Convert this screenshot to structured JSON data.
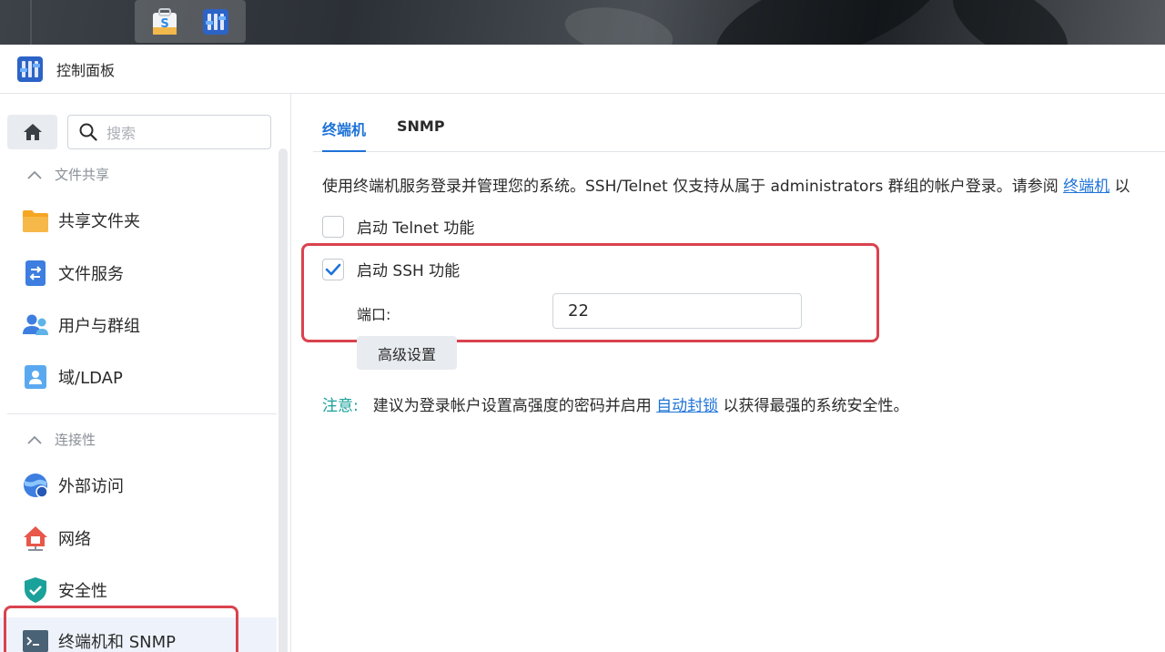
{
  "window": {
    "title": "控制面板"
  },
  "sidebar": {
    "search_placeholder": "搜索",
    "sections": [
      {
        "label": "文件共享",
        "items": [
          {
            "label": "共享文件夹",
            "icon": "folder-icon"
          },
          {
            "label": "文件服务",
            "icon": "file-services-icon"
          },
          {
            "label": "用户与群组",
            "icon": "users-icon"
          },
          {
            "label": "域/LDAP",
            "icon": "domain-icon"
          }
        ]
      },
      {
        "label": "连接性",
        "items": [
          {
            "label": "外部访问",
            "icon": "external-access-icon"
          },
          {
            "label": "网络",
            "icon": "network-icon"
          },
          {
            "label": "安全性",
            "icon": "shield-icon"
          },
          {
            "label": "终端机和 SNMP",
            "icon": "terminal-icon",
            "active": true
          }
        ]
      }
    ]
  },
  "main": {
    "tabs": [
      {
        "label": "终端机",
        "active": true
      },
      {
        "label": "SNMP",
        "active": false
      }
    ],
    "description_prefix": "使用终端机服务登录并管理您的系统。SSH/Telnet 仅支持从属于 administrators 群组的帐户登录。请参阅 ",
    "description_link": "终端机",
    "description_suffix": " 以",
    "telnet": {
      "label": "启动 Telnet 功能",
      "checked": false
    },
    "ssh": {
      "label": "启动 SSH 功能",
      "checked": true
    },
    "port": {
      "label": "端口:",
      "value": "22"
    },
    "advanced_button": "高级设置",
    "note": {
      "tag": "注意:",
      "text_prefix": "建议为登录帐户设置高强度的密码并启用 ",
      "link": "自动封锁",
      "text_suffix": " 以获得最强的系统安全性。"
    }
  },
  "colors": {
    "accent": "#1e73d8",
    "highlight": "#d9434e",
    "note": "#1aa19a"
  }
}
